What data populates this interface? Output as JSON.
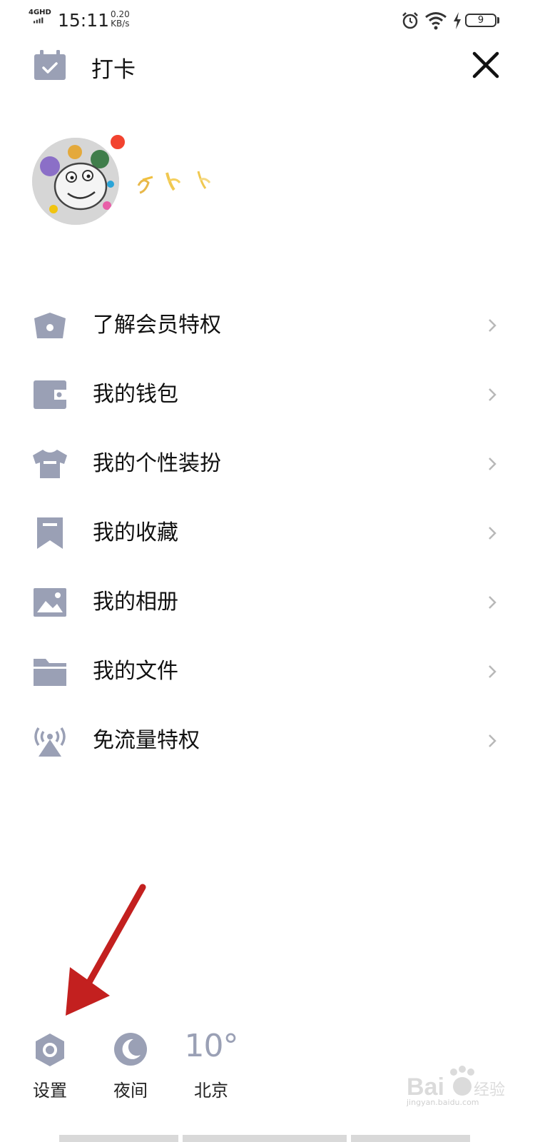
{
  "status_bar": {
    "network": "4GHD",
    "time": "15:11",
    "speed_value": "0.20",
    "speed_unit": "KB/s",
    "battery": "9"
  },
  "header": {
    "checkin_label": "打卡"
  },
  "menu": {
    "items": [
      {
        "label": "了解会员特权",
        "icon": "crown-icon"
      },
      {
        "label": "我的钱包",
        "icon": "wallet-icon"
      },
      {
        "label": "我的个性装扮",
        "icon": "tshirt-icon"
      },
      {
        "label": "我的收藏",
        "icon": "bookmark-icon"
      },
      {
        "label": "我的相册",
        "icon": "photo-icon"
      },
      {
        "label": "我的文件",
        "icon": "folder-icon"
      },
      {
        "label": "免流量特权",
        "icon": "antenna-icon"
      }
    ]
  },
  "bottom_bar": {
    "settings_label": "设置",
    "night_label": "夜间",
    "weather_temp": "10°",
    "weather_city": "北京"
  },
  "watermark": {
    "text": "jingyan.baidu.com"
  },
  "colors": {
    "icon_gray": "#9aa0b5",
    "accent_red": "#c3201f",
    "badge_red": "#f2432f"
  }
}
